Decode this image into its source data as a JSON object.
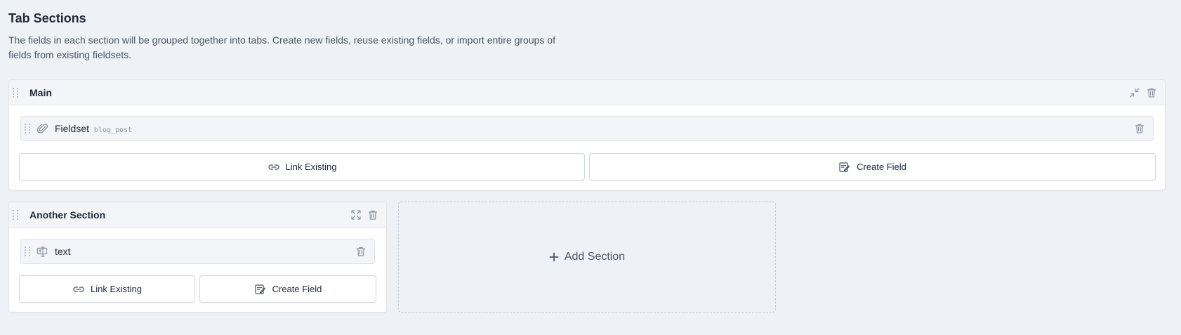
{
  "page": {
    "title": "Tab Sections",
    "description": "The fields in each section will be grouped together into tabs. Create new fields, reuse existing fields, or import entire groups of fields from existing fieldsets."
  },
  "sections": [
    {
      "title": "Main",
      "header_icons": [
        "collapse-icon",
        "trash-icon"
      ],
      "fields": [
        {
          "icon": "paperclip-icon",
          "label": "Fieldset",
          "handle": "blog_post"
        }
      ],
      "buttons": {
        "link_existing": "Link Existing",
        "create_field": "Create Field"
      }
    },
    {
      "title": "Another Section",
      "header_icons": [
        "expand-icon",
        "trash-icon"
      ],
      "fields": [
        {
          "icon": "text-field-icon",
          "label": "text"
        }
      ],
      "buttons": {
        "link_existing": "Link Existing",
        "create_field": "Create Field"
      }
    }
  ],
  "add_section": {
    "label": "Add Section",
    "icon": "plus-icon"
  },
  "colors": {
    "background": "#eef1f5",
    "panel": "#ffffff",
    "header": "#f3f5f8",
    "icon": "#8a94a3"
  }
}
